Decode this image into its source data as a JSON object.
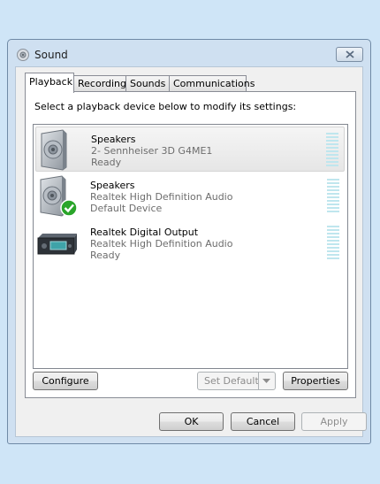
{
  "window": {
    "title": "Sound"
  },
  "tabs": [
    {
      "label": "Playback",
      "active": true
    },
    {
      "label": "Recording"
    },
    {
      "label": "Sounds"
    },
    {
      "label": "Communications"
    }
  ],
  "panel": {
    "instructions": "Select a playback device below to modify its settings:"
  },
  "devices": [
    {
      "name": "Speakers",
      "description": "2- Sennheiser 3D G4ME1",
      "status": "Ready",
      "icon": "speaker-icon",
      "selected": true
    },
    {
      "name": "Speakers",
      "description": "Realtek High Definition Audio",
      "status": "Default Device",
      "icon": "speaker-default-icon"
    },
    {
      "name": "Realtek Digital Output",
      "description": "Realtek High Definition Audio",
      "status": "Ready",
      "icon": "digital-output-icon"
    }
  ],
  "buttons": {
    "configure": "Configure",
    "set_default": "Set Default",
    "properties": "Properties",
    "ok": "OK",
    "cancel": "Cancel",
    "apply": "Apply"
  },
  "colors": {
    "desktop": "#cfe5f7",
    "frame": "#cfe0f1",
    "meter": "#bfe6ee",
    "check": "#2aa52a"
  }
}
